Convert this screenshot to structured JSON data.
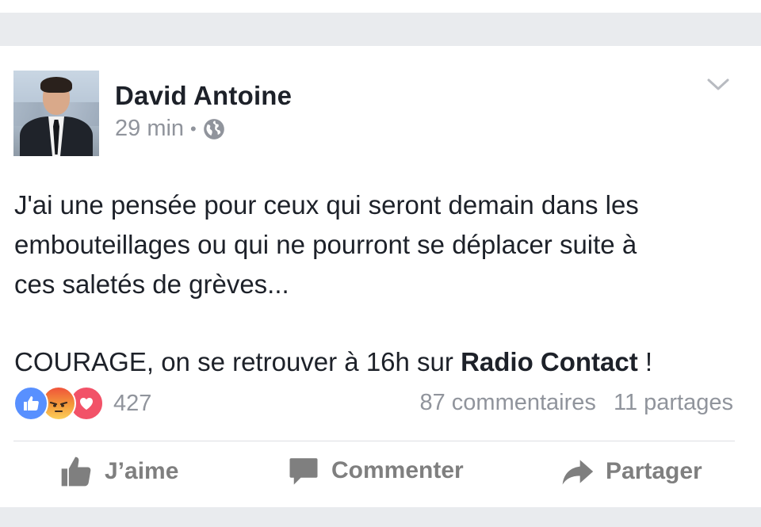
{
  "post": {
    "author": "David Antoine",
    "time": "29 min",
    "separator": "•",
    "privacy_icon": "globe-icon",
    "menu_icon": "chevron-down-icon",
    "text_lines": [
      "J'ai une pensée pour ceux qui seront demain dans les",
      "embouteillages ou qui ne pourront se déplacer suite à",
      "ces saletés de grèves..."
    ],
    "courage_prefix": "COURAGE, on se retrouver à 16h sur ",
    "courage_bold": "Radio Contact",
    "courage_suffix": " !"
  },
  "reactions": {
    "icons": [
      "like-icon",
      "angry-icon",
      "love-icon"
    ],
    "count": "427",
    "comments": "87 commentaires",
    "shares": "11 partages"
  },
  "actions": {
    "like_label": "J’aime",
    "comment_label": "Commenter",
    "share_label": "Partager"
  },
  "colors": {
    "background": "#e9ebee",
    "text": "#1d2129",
    "meta": "#90949c",
    "like_blue": "#5890ff",
    "love_red": "#f25268",
    "action_gray": "#7f7f7f"
  }
}
